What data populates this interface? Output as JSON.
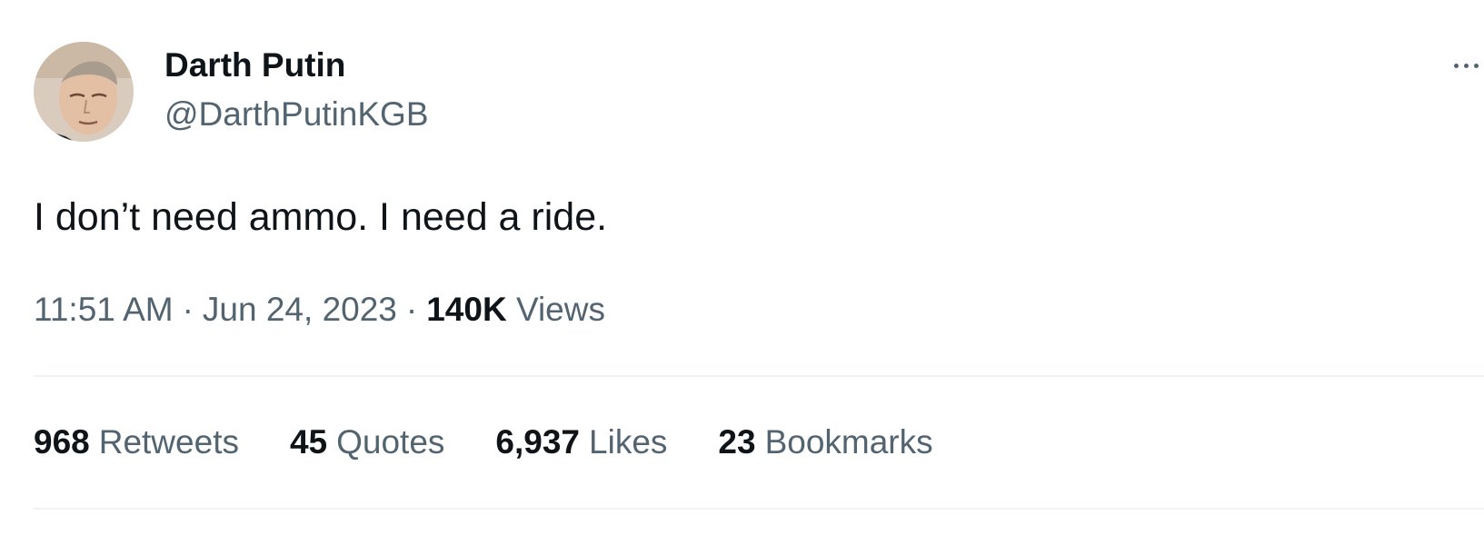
{
  "tweet": {
    "author": {
      "display_name": "Darth Putin",
      "handle": "@DarthPutinKGB"
    },
    "text": "I don’t need ammo. I need a ride.",
    "meta": {
      "time": "11:51 AM",
      "separator": "·",
      "date": "Jun 24, 2023",
      "views_count": "140K",
      "views_label": "Views"
    },
    "stats": [
      {
        "count": "968",
        "label": "Retweets"
      },
      {
        "count": "45",
        "label": "Quotes"
      },
      {
        "count": "6,937",
        "label": "Likes"
      },
      {
        "count": "23",
        "label": "Bookmarks"
      }
    ]
  },
  "icons": {
    "avatar": "avatar-photo",
    "more": "more-icon"
  },
  "colors": {
    "primary_text": "#0f1419",
    "secondary_text": "#536471",
    "divider": "#eff3f4",
    "background": "#ffffff"
  }
}
